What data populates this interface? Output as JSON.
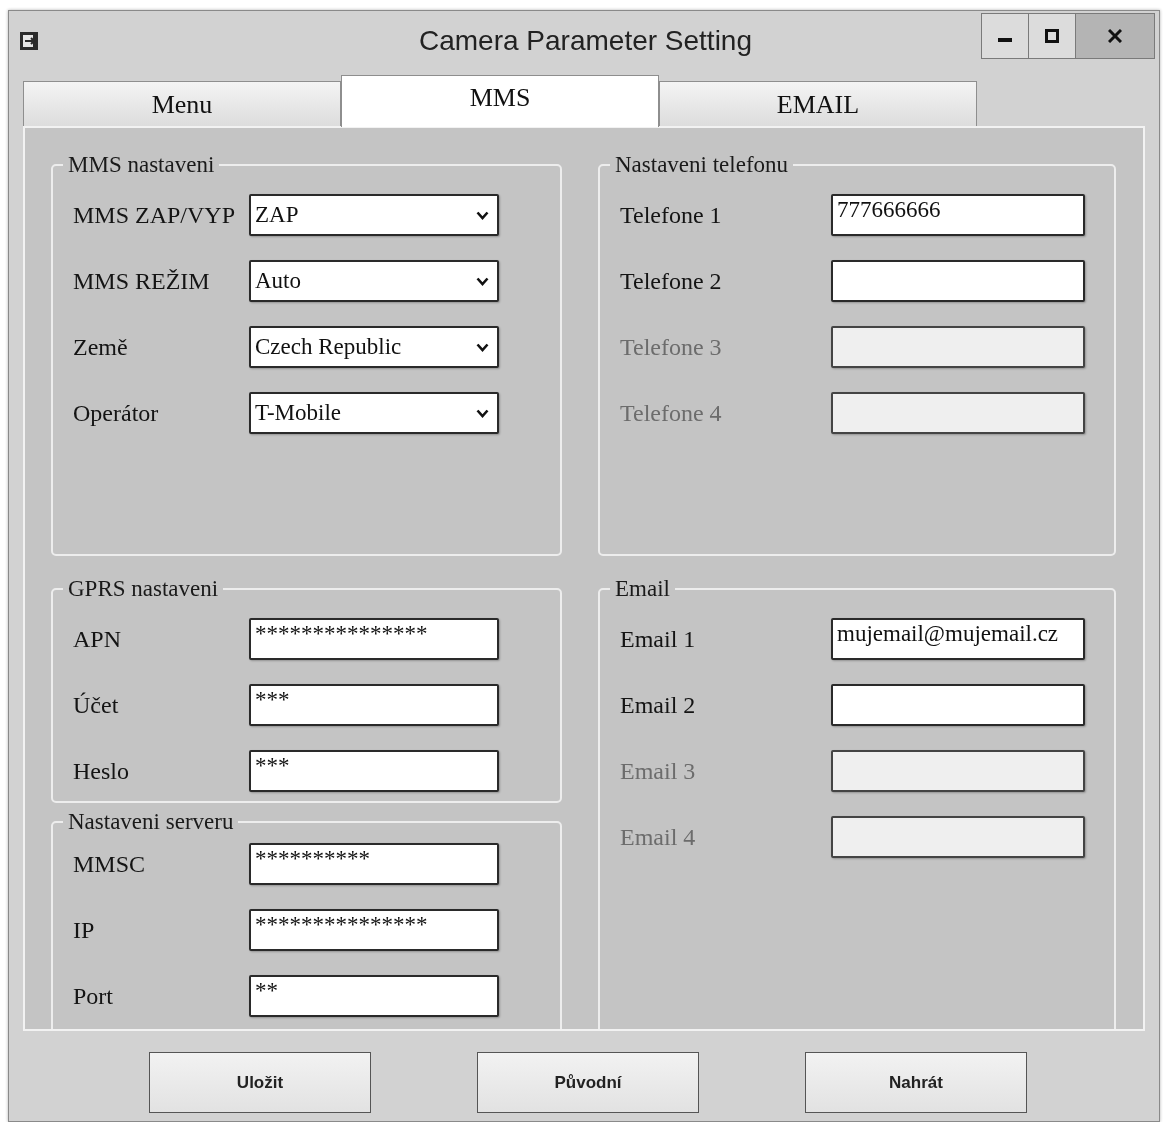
{
  "window": {
    "title": "Camera Parameter Setting"
  },
  "tabs": [
    {
      "label": "Menu",
      "selected": false
    },
    {
      "label": "MMS",
      "selected": true
    },
    {
      "label": "EMAIL",
      "selected": false
    }
  ],
  "left_groups": [
    {
      "title": "MMS nastaveni",
      "fields": [
        {
          "kind": "select",
          "label": "MMS ZAP/VYP",
          "value": "ZAP",
          "disabled": false
        },
        {
          "kind": "select",
          "label": "MMS REŽIM",
          "value": "Auto",
          "disabled": false
        },
        {
          "kind": "select",
          "label": "Země",
          "value": "Czech Republic",
          "disabled": false
        },
        {
          "kind": "select",
          "label": "Operátor",
          "value": "T-Mobile",
          "disabled": false
        }
      ]
    },
    {
      "title": "GPRS nastaveni",
      "fields": [
        {
          "kind": "text",
          "label": "APN",
          "value": "***************",
          "disabled": false
        },
        {
          "kind": "text",
          "label": "Účet",
          "value": "***",
          "disabled": false
        },
        {
          "kind": "text",
          "label": "Heslo",
          "value": "***",
          "disabled": false
        }
      ]
    },
    {
      "title": "Nastaveni serveru",
      "fields": [
        {
          "kind": "text",
          "label": "MMSC",
          "value": "**********",
          "disabled": false
        },
        {
          "kind": "text",
          "label": "IP",
          "value": "***************",
          "disabled": false
        },
        {
          "kind": "text",
          "label": "Port",
          "value": "**",
          "disabled": false
        }
      ]
    }
  ],
  "right_groups": [
    {
      "title": "Nastaveni telefonu",
      "fields": [
        {
          "kind": "text",
          "label": "Telefone 1",
          "value": "777666666",
          "disabled": false
        },
        {
          "kind": "text",
          "label": "Telefone 2",
          "disabled": false
        },
        {
          "kind": "text",
          "label": "Telefone 3",
          "disabled": true
        },
        {
          "kind": "text",
          "label": "Telefone 4",
          "disabled": true
        }
      ]
    },
    {
      "title": "Email",
      "fields": [
        {
          "kind": "text",
          "label": "Email 1",
          "value": "mujemail@mujemail.cz",
          "disabled": false
        },
        {
          "kind": "text",
          "label": "Email 2",
          "disabled": false
        },
        {
          "kind": "text",
          "label": "Email 3",
          "disabled": true
        },
        {
          "kind": "text",
          "label": "Email 4",
          "disabled": true
        }
      ]
    }
  ],
  "buttons": [
    "Uložit",
    "Původní",
    "Nahrát"
  ]
}
